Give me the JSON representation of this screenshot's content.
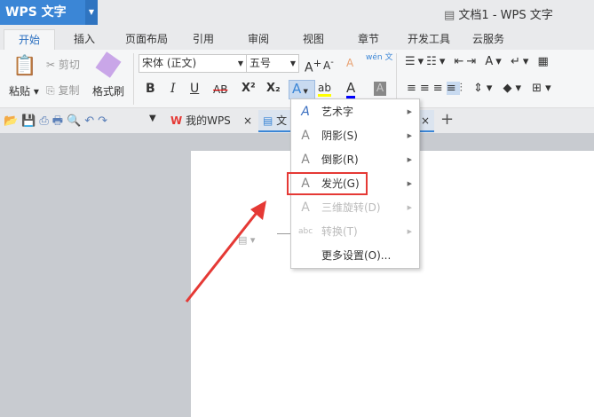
{
  "app": {
    "logo": "WPS 文字",
    "window_title": "文档1 - WPS 文字"
  },
  "tabs": [
    "开始",
    "插入",
    "页面布局",
    "引用",
    "审阅",
    "视图",
    "章节",
    "开发工具",
    "云服务"
  ],
  "ribbon": {
    "paste": "粘贴",
    "cut": "剪切",
    "copy": "复制",
    "format_painter": "格式刷",
    "font": "宋体 (正文)",
    "size": "五号",
    "bold": "B",
    "italic": "I",
    "underline": "U",
    "strike": "AB",
    "sup": "X²",
    "sub": "X₂",
    "phonetic": "wén 文"
  },
  "quick_access": {
    "my_wps": "我的WPS",
    "doc_tab": "文",
    "add": "+"
  },
  "menu": {
    "items": [
      {
        "label": "艺术字",
        "icon": "A",
        "disabled": false,
        "submenu": true
      },
      {
        "label": "阴影(S)",
        "icon": "A",
        "disabled": false,
        "submenu": true
      },
      {
        "label": "倒影(R)",
        "icon": "A",
        "disabled": false,
        "submenu": true
      },
      {
        "label": "发光(G)",
        "icon": "A",
        "disabled": false,
        "submenu": true
      },
      {
        "label": "三维旋转(D)",
        "icon": "A",
        "disabled": true,
        "submenu": true
      },
      {
        "label": "转换(T)",
        "icon": "abc",
        "disabled": true,
        "submenu": true
      },
      {
        "label": "更多设置(O)...",
        "icon": "",
        "disabled": false,
        "submenu": false
      }
    ]
  },
  "colors": {
    "accent": "#3b86d6",
    "highlight": "#e53935"
  }
}
